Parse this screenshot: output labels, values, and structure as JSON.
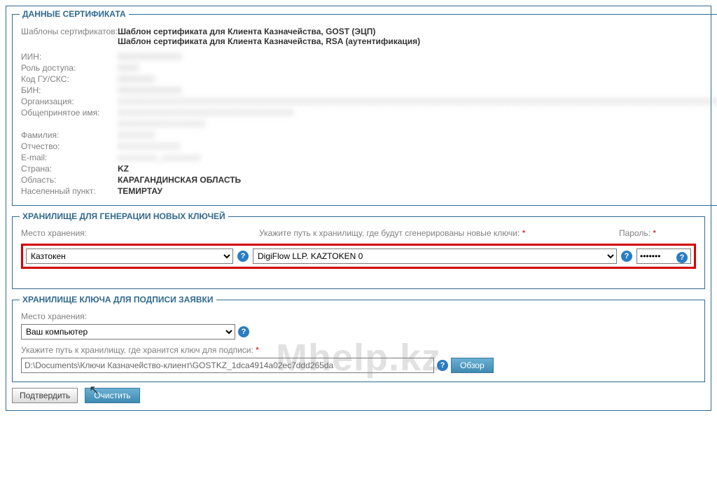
{
  "fieldset1": {
    "legend": "ДАННЫЕ СЕРТИФИКАТА",
    "templates_label": "Шаблоны сертификатов:",
    "template1": "Шаблон сертификата для Клиента Казначейства, GOST (ЭЦП)",
    "template2": "Шаблон сертификата для Клиента Казначейства, RSA (аутентификация)",
    "rows": {
      "iin_label": "ИИН:",
      "role_label": "Роль доступа:",
      "gucode_label": "Код ГУ/СКС:",
      "bin_label": "БИН:",
      "org_label": "Организация:",
      "cn_label": "Общепринятое имя:",
      "surname_label": "Фамилия:",
      "patronymic_label": "Отчество:",
      "email_label": "E-mail:",
      "country_label": "Страна:",
      "country_value": "KZ",
      "region_label": "Область:",
      "region_value": "КАРАГАНДИНСКАЯ ОБЛАСТЬ",
      "city_label": "Населенный пункт:",
      "city_value": "ТЕМИРТАУ"
    }
  },
  "fieldset2": {
    "legend": "ХРАНИЛИЩЕ ДЛЯ ГЕНЕРАЦИИ НОВЫХ КЛЮЧЕЙ",
    "loc_label": "Место хранения:",
    "loc_value": "Казтокен",
    "path_label": "Укажите путь к хранилищу, где будут сгенерированы новые ключи:",
    "path_value": "DigiFlow LLP. KAZTOKEN 0",
    "pwd_label": "Пароль:",
    "pwd_value": "•••••••"
  },
  "fieldset3": {
    "legend": "ХРАНИЛИЩЕ КЛЮЧА ДЛЯ ПОДПИСИ ЗАЯВКИ",
    "loc_label": "Место хранения:",
    "loc_value": "Ваш компьютер",
    "path_label": "Укажите путь к хранилищу, где хранится ключ для подписи:",
    "path_value": "D:\\Documents\\Ключи Казначейство-клиент\\GOSTKZ_1dca4914a02ec7ddd265da",
    "browse": "Обзор"
  },
  "actions": {
    "confirm": "Подтвердить",
    "clear": "Очистить"
  },
  "watermark": "Mhelp.kz",
  "help_glyph": "?"
}
